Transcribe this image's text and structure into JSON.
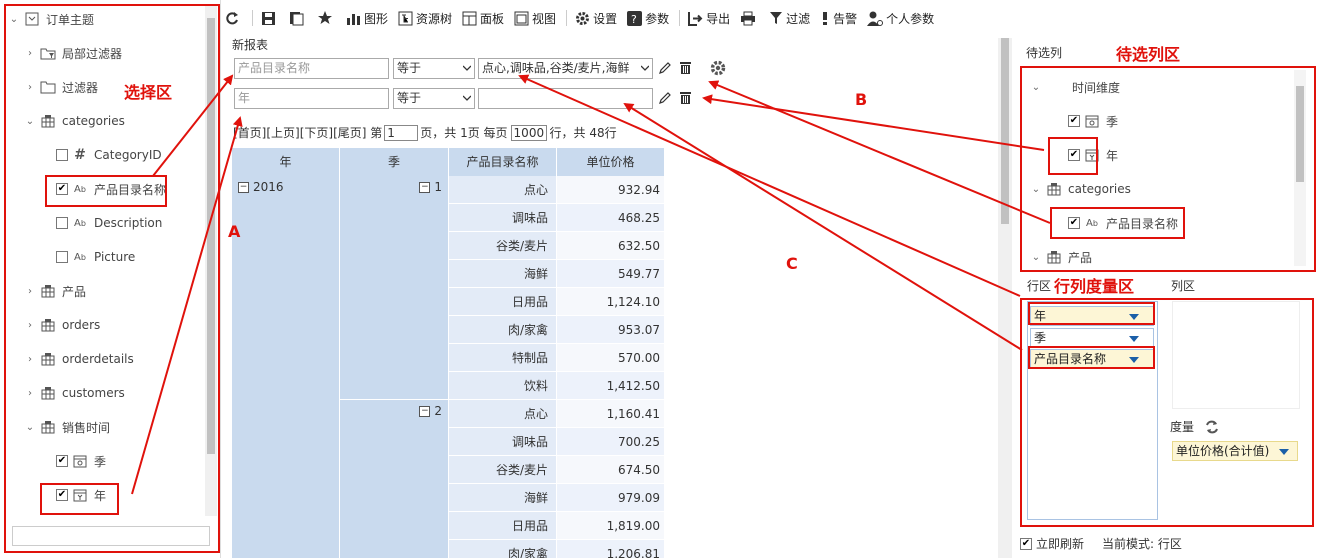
{
  "left_tree": {
    "root": "订单主题",
    "items": [
      {
        "label": "局部过滤器",
        "type": "node"
      },
      {
        "label": "过滤器",
        "type": "folder"
      },
      {
        "label": "categories",
        "type": "table"
      },
      {
        "label": "CategoryID",
        "type": "field"
      },
      {
        "label": "产品目录名称",
        "type": "field"
      },
      {
        "label": "Description",
        "type": "field"
      },
      {
        "label": "Picture",
        "type": "field"
      },
      {
        "label": "产品",
        "type": "table"
      },
      {
        "label": "orders",
        "type": "table"
      },
      {
        "label": "orderdetails",
        "type": "table"
      },
      {
        "label": "customers",
        "type": "table"
      },
      {
        "label": "销售时间",
        "type": "table"
      },
      {
        "label": "季",
        "type": "field"
      },
      {
        "label": "年",
        "type": "field"
      }
    ]
  },
  "toolbar": {
    "chart": "图形",
    "resource_tree": "资源树",
    "panel": "面板",
    "view": "视图",
    "settings": "设置",
    "params": "参数",
    "export": "导出",
    "filter": "过滤",
    "alert": "告警",
    "personal_params": "个人参数"
  },
  "report": {
    "title": "新报表",
    "filters": [
      {
        "field_placeholder": "产品目录名称",
        "operator": "等于",
        "value": "点心,调味品,谷类/麦片,海鲜"
      },
      {
        "field_placeholder": "年",
        "operator": "等于",
        "value": ""
      }
    ],
    "pager": {
      "text_prefix": "[首页][上页][下页][尾页] 第",
      "page": "1",
      "text_mid": "页，共 1页 每页",
      "per_page": "1000",
      "text_suffix": "行，共 48行"
    }
  },
  "table": {
    "headers": [
      "年",
      "季",
      "产品目录名称",
      "单位价格"
    ],
    "year": "2016",
    "quarters": [
      {
        "q": "1",
        "rows": [
          [
            "点心",
            "932.94"
          ],
          [
            "调味品",
            "468.25"
          ],
          [
            "谷类/麦片",
            "632.50"
          ],
          [
            "海鲜",
            "549.77"
          ],
          [
            "日用品",
            "1,124.10"
          ],
          [
            "肉/家禽",
            "953.07"
          ],
          [
            "特制品",
            "570.00"
          ],
          [
            "饮料",
            "1,412.50"
          ]
        ]
      },
      {
        "q": "2",
        "rows": [
          [
            "点心",
            "1,160.41"
          ],
          [
            "调味品",
            "700.25"
          ],
          [
            "谷类/麦片",
            "674.50"
          ],
          [
            "海鲜",
            "979.09"
          ],
          [
            "日用品",
            "1,819.00"
          ],
          [
            "肉/家禽",
            "1,206.81"
          ]
        ]
      }
    ]
  },
  "right_panel": {
    "candidates_title": "待选列",
    "candidates": {
      "time_dim": "时间维度",
      "quarter": "季",
      "year": "年",
      "categories": "categories",
      "cat_name": "产品目录名称",
      "product": "产品"
    },
    "row_area": "行区",
    "col_area": "列区",
    "row_fields": [
      "年",
      "季",
      "产品目录名称"
    ],
    "measure_label": "度量",
    "measure_field": "单位价格(合计值)",
    "refresh_label": "立即刷新",
    "mode_label": "当前模式: 行区"
  },
  "annotations": {
    "select_area": "选择区",
    "candidate_area": "待选列区",
    "rcm_area": "行列度量区",
    "A": "A",
    "B": "B",
    "C": "C"
  },
  "colors": {
    "annotation": "#e0120c",
    "header": "#c9daee",
    "row_band": "#e3ebf7",
    "value_band": "#edf2fb"
  }
}
